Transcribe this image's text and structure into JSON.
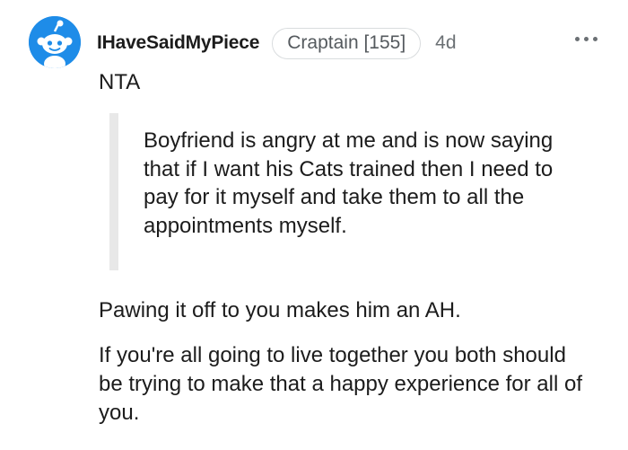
{
  "comment": {
    "author": "IHaveSaidMyPiece",
    "flair": "Craptain [155]",
    "age": "4d",
    "avatar_icon": "reddit-snoo-avatar-icon",
    "more_icon": "more-options-icon",
    "avatar_color": "#1e8ce8",
    "body": {
      "line1": "NTA",
      "quote": "Boyfriend is angry at me and is now saying that if I want his Cats trained then I need to pay for it myself and take them to all the appointments myself.",
      "paragraph1": "Pawing it off to you makes him an AH.",
      "paragraph2": "If you're all going to live together you both should be trying to make that a happy experience for all of you."
    }
  }
}
